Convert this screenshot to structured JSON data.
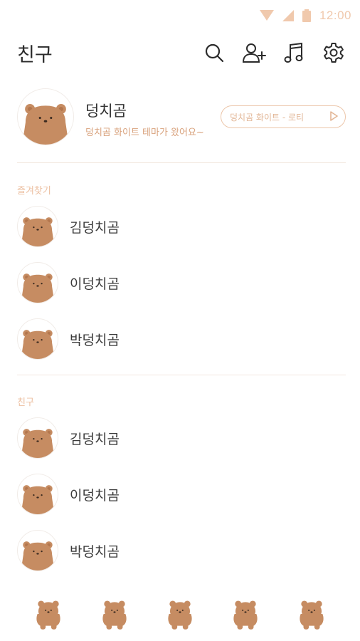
{
  "status_bar": {
    "time": "12:00"
  },
  "header": {
    "title": "친구",
    "icons": [
      "search-icon",
      "add-friend-icon",
      "music-icon",
      "settings-icon"
    ]
  },
  "profile": {
    "name": "덩치곰",
    "status_message": "덩치곰 화이트 테마가 왔어요~",
    "music_label": "덩치곰 화이트 - 로티"
  },
  "favorites": {
    "label": "즐겨찾기",
    "items": [
      {
        "name": "김덩치곰"
      },
      {
        "name": "이덩치곰"
      },
      {
        "name": "박덩치곰"
      }
    ]
  },
  "friends": {
    "label": "친구",
    "items": [
      {
        "name": "김덩치곰"
      },
      {
        "name": "이덩치곰"
      },
      {
        "name": "박덩치곰"
      }
    ]
  },
  "bottom_nav": {
    "tabs": [
      "bear-tab-icon",
      "bear-tab-icon",
      "bear-tab-icon",
      "bear-tab-icon",
      "bear-tab-icon"
    ]
  },
  "colors": {
    "accent": "#d9a37e",
    "bear": "#c68c62",
    "status_bar": "#f0c9ad"
  }
}
